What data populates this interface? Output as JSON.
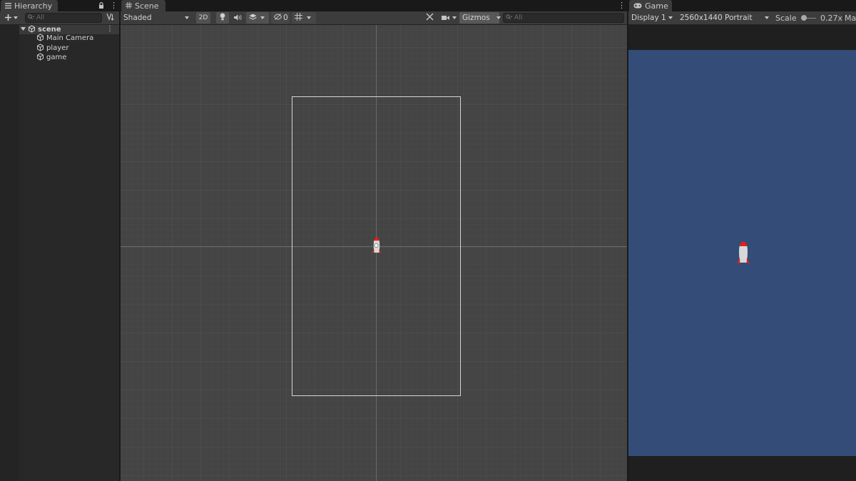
{
  "hierarchy": {
    "tab_label": "Hierarchy",
    "search_placeholder": "All",
    "scene_name": "scene",
    "items": [
      {
        "label": "Main Camera"
      },
      {
        "label": "player"
      },
      {
        "label": "game"
      }
    ]
  },
  "scene_view": {
    "tab_label": "Scene",
    "shading_mode": "Shaded",
    "mode_2d_label": "2D",
    "hidden_count": "0",
    "gizmos_label": "Gizmos",
    "search_placeholder": "All"
  },
  "game_view": {
    "tab_label": "Game",
    "display": "Display 1",
    "resolution": "2560x1440 Portrait",
    "scale_label": "Scale",
    "scale_value": "0.27x",
    "maximize_label": "Ma",
    "background_color": "#334d78"
  },
  "colors": {
    "rocket_tip": "#e02020",
    "rocket_body": "#d8d8d8"
  }
}
